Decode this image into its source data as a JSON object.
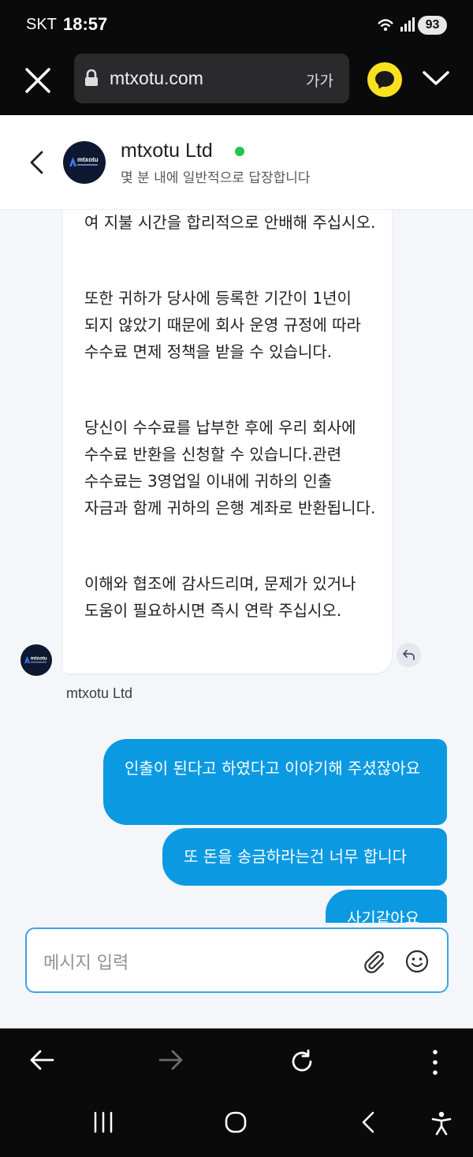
{
  "status_bar": {
    "carrier": "SKT",
    "time": "18:57",
    "battery": "93"
  },
  "browser": {
    "url": "mtxotu.com",
    "text_size_label": "가가",
    "icons": [
      "close-icon",
      "lock-icon",
      "kakaotalk-icon",
      "chevron-down-icon"
    ]
  },
  "chat_header": {
    "title": "mtxotu Ltd",
    "status": "online",
    "subtitle": "몇 분 내에 일반적으로 답장합니다",
    "avatar_text": "mtxotu"
  },
  "messages": {
    "bot": {
      "paragraphs": [
        "여 지불 시간을 합리적으로 안배해 주십시오.",
        "또한 귀하가 당사에 등록한 기간이 1년이 되지 않았기 때문에 회사 운영 규정에 따라 수수료 면제 정책을 받을 수 있습니다.",
        "당신이 수수료를 납부한 후에 우리 회사에 수수료 반환을 신청할 수 있습니다.관련 수수료는 3영업일 이내에 귀하의 인출 자금과 함께 귀하의 은행 계좌로 반환됩니다.",
        "이해와 협조에 감사드리며, 문제가 있거나 도움이 필요하시면 즉시 연락 주십시오."
      ],
      "sender": "mtxotu Ltd"
    },
    "user": [
      "인출이 된다고 하였다고 이야기해 주셨잖아요",
      "또 돈을 송금하라는건 너무 합니다",
      "사기같아요"
    ]
  },
  "composer": {
    "placeholder": "메시지 입력"
  },
  "colors": {
    "user_bubble": "#0b9ae2",
    "online_dot": "#27c24c",
    "composer_border": "#3ba3e6"
  }
}
